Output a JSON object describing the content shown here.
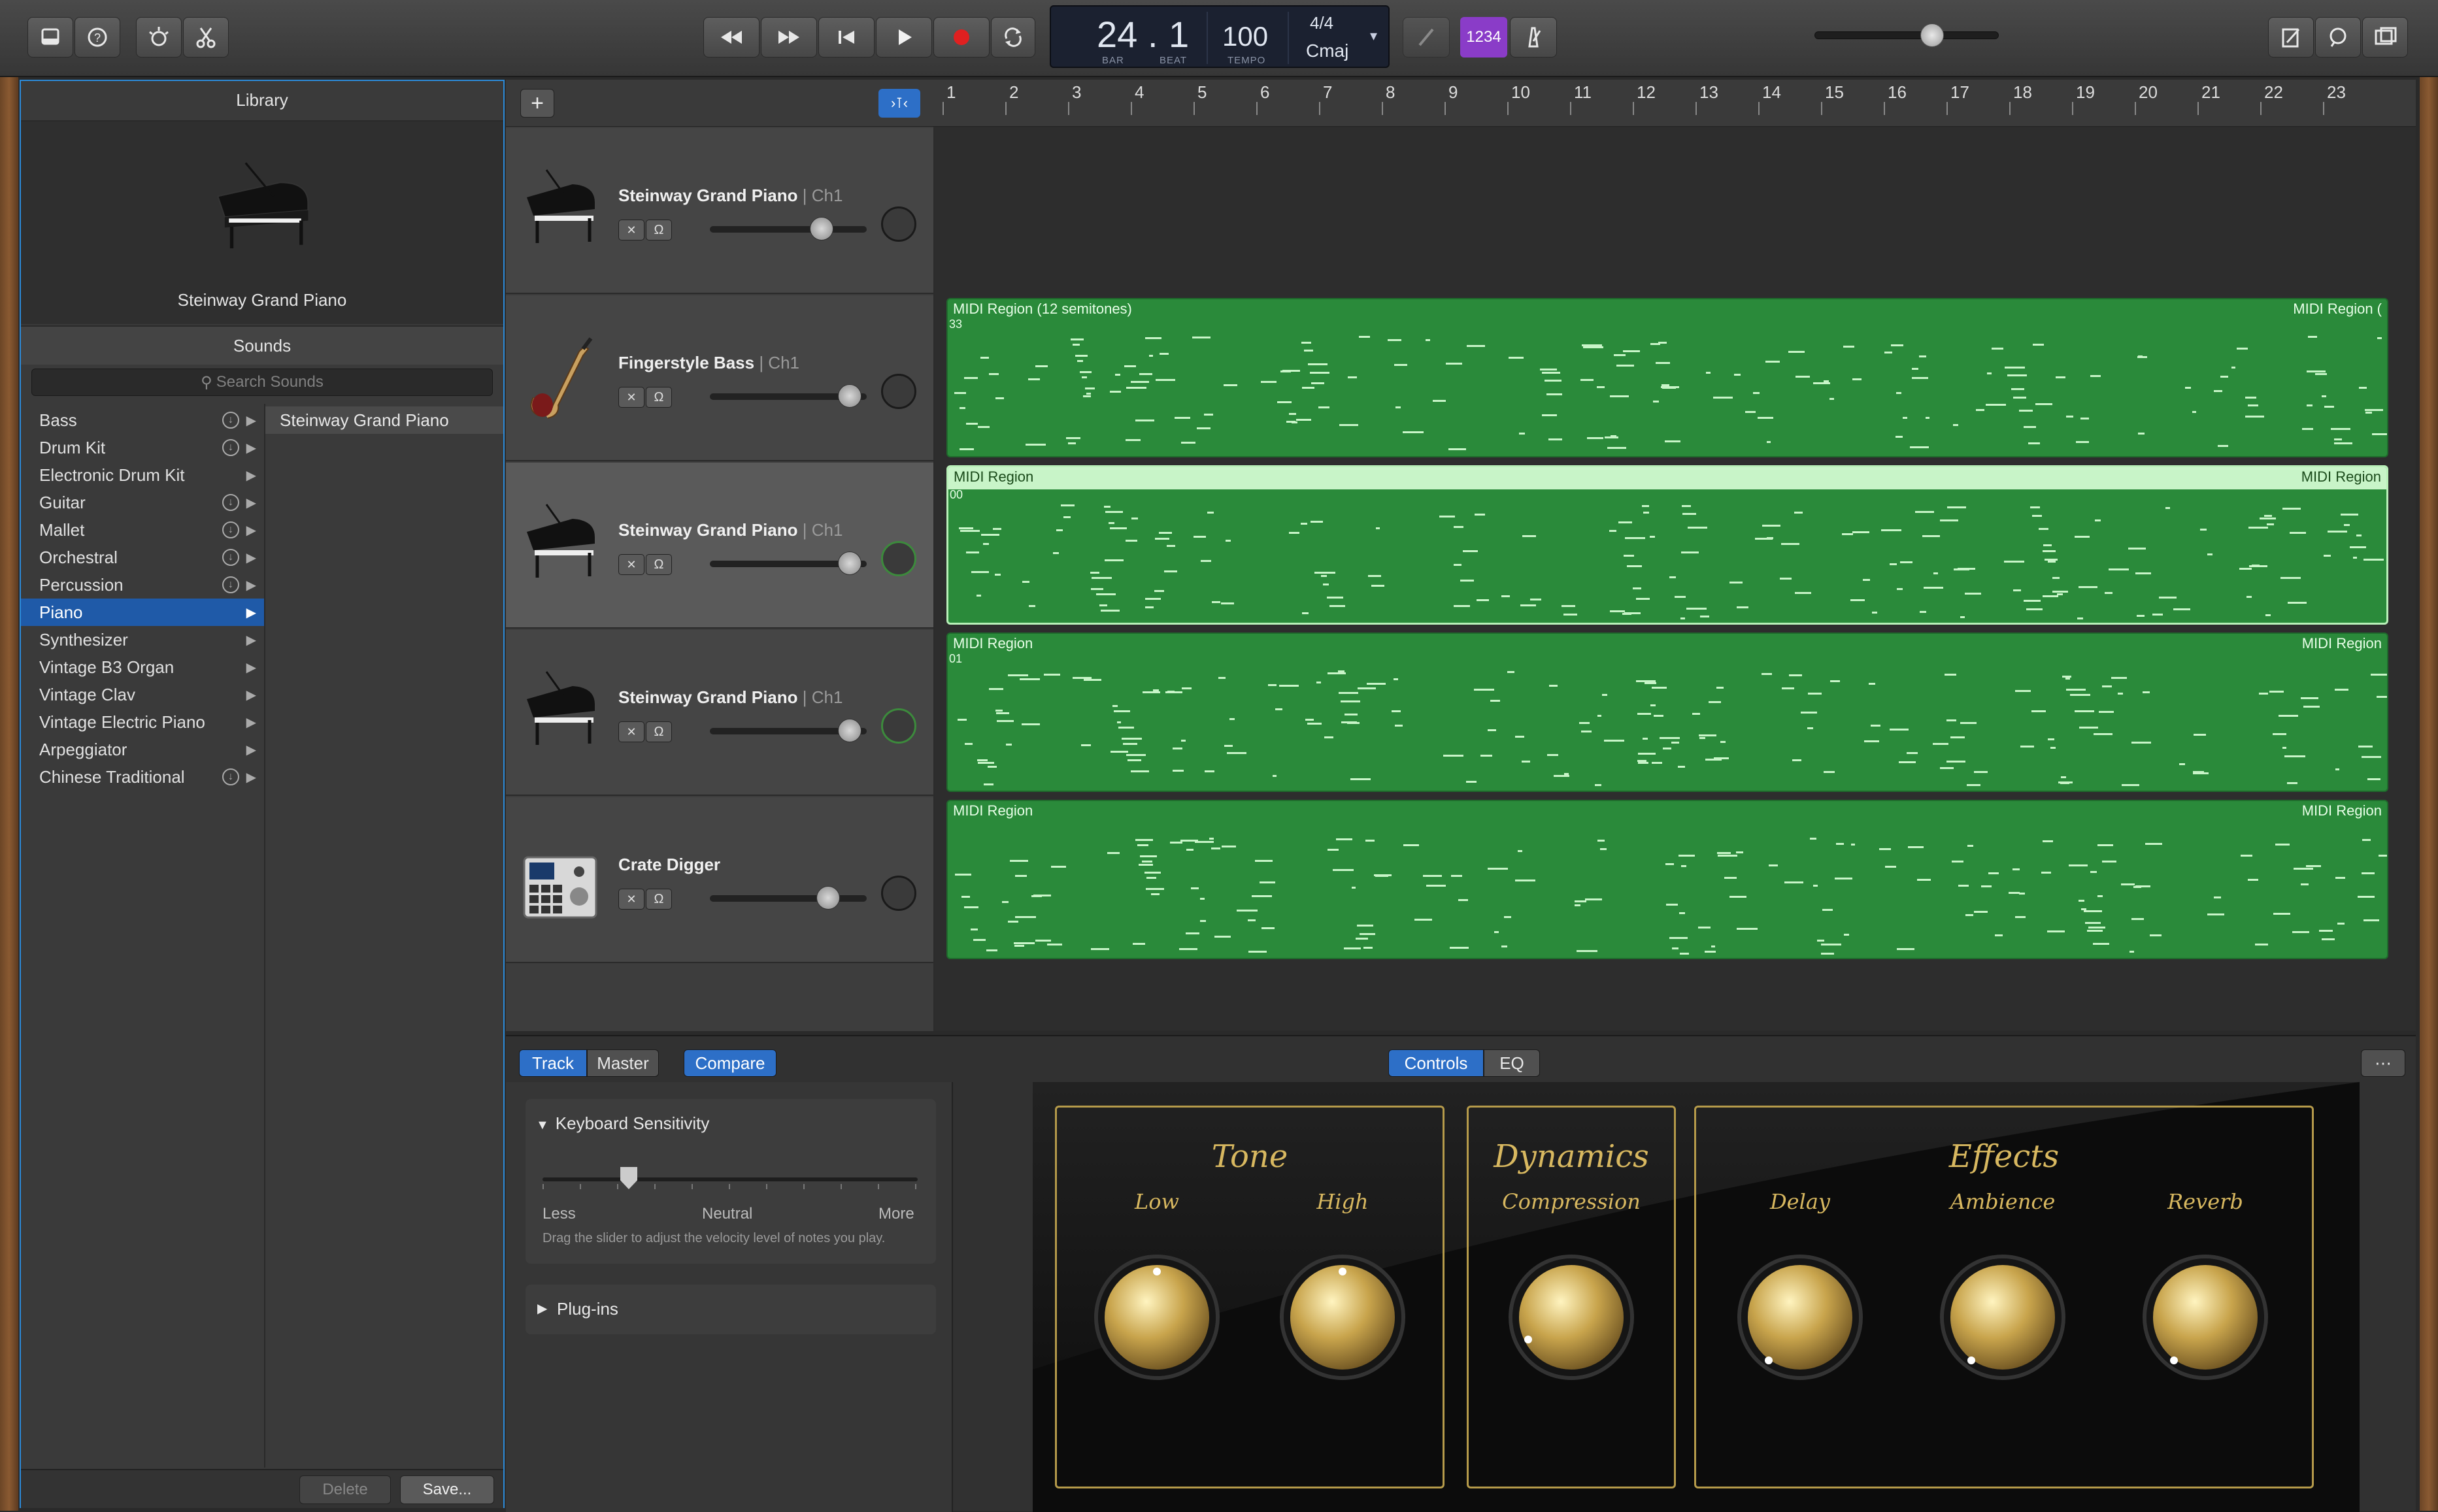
{
  "colors": {
    "region_green": "#2a8a3a",
    "selection_blue": "#2d6fc7",
    "record_red": "#e02020",
    "count_in_purple": "#8a3cc8",
    "gold": "#d8b860"
  },
  "toolbar": {
    "icons": [
      "library-icon",
      "help-icon",
      "smart-controls-icon",
      "editors-icon",
      "rewind-icon",
      "fast-forward-icon",
      "go-to-start-icon",
      "play-icon",
      "record-icon",
      "cycle-icon",
      "tuner-icon",
      "metronome-icon",
      "notepad-icon",
      "loop-browser-icon",
      "media-browser-icon"
    ],
    "lcd": {
      "bar": "24",
      "beat": "1",
      "bar_label": "BAR",
      "beat_label": "BEAT",
      "tempo": "100",
      "tempo_label": "TEMPO",
      "time_sig": "4/4",
      "key": "Cmaj"
    },
    "count_in": "1234",
    "master_volume": 0.66
  },
  "library": {
    "title": "Library",
    "patch_name": "Steinway Grand Piano",
    "sounds_title": "Sounds",
    "search_placeholder": "Search Sounds",
    "categories": [
      {
        "label": "Bass",
        "download": true
      },
      {
        "label": "Drum Kit",
        "download": true
      },
      {
        "label": "Electronic Drum Kit",
        "download": false
      },
      {
        "label": "Guitar",
        "download": true
      },
      {
        "label": "Mallet",
        "download": true
      },
      {
        "label": "Orchestral",
        "download": true
      },
      {
        "label": "Percussion",
        "download": true
      },
      {
        "label": "Piano",
        "download": false,
        "selected": true
      },
      {
        "label": "Synthesizer",
        "download": false
      },
      {
        "label": "Vintage B3 Organ",
        "download": false
      },
      {
        "label": "Vintage Clav",
        "download": false
      },
      {
        "label": "Vintage Electric Piano",
        "download": false
      },
      {
        "label": "Arpeggiator",
        "download": false
      },
      {
        "label": "Chinese Traditional",
        "download": true
      }
    ],
    "patches": [
      "Steinway Grand Piano"
    ],
    "delete_label": "Delete",
    "save_label": "Save..."
  },
  "tracks": [
    {
      "name": "Steinway Grand Piano",
      "channel": "| Ch1",
      "icon": "grand-piano-icon",
      "volume": 0.75
    },
    {
      "name": "Fingerstyle Bass",
      "channel": "| Ch1",
      "icon": "bass-guitar-icon",
      "volume": 0.96
    },
    {
      "name": "Steinway Grand Piano",
      "channel": "| Ch1",
      "icon": "grand-piano-icon",
      "volume": 0.96,
      "selected": true
    },
    {
      "name": "Steinway Grand Piano",
      "channel": "| Ch1",
      "icon": "grand-piano-icon",
      "volume": 0.96
    },
    {
      "name": "Crate Digger",
      "channel": "",
      "icon": "drum-machine-icon",
      "volume": 0.8
    }
  ],
  "ruler": [
    "1",
    "2",
    "3",
    "4",
    "5",
    "6",
    "7",
    "8",
    "9",
    "10",
    "11",
    "12",
    "13",
    "14",
    "15",
    "16",
    "17",
    "18",
    "19",
    "20",
    "21",
    "22",
    "23"
  ],
  "regions": [
    {
      "track": 1,
      "left_label": "MIDI Region (12 semitones)",
      "right_label": "MIDI Region (",
      "sub": "33"
    },
    {
      "track": 2,
      "left_label": "MIDI Region",
      "right_label": "MIDI Region",
      "sub": "00",
      "selected": true
    },
    {
      "track": 3,
      "left_label": "MIDI Region",
      "right_label": "MIDI Region",
      "sub": "01"
    },
    {
      "track": 4,
      "left_label": "MIDI Region",
      "right_label": "MIDI Region",
      "sub": ""
    }
  ],
  "bottom": {
    "tabs": {
      "track": "Track",
      "master": "Master",
      "compare": "Compare"
    },
    "view_tabs": {
      "controls": "Controls",
      "eq": "EQ"
    },
    "keyboard_sensitivity": {
      "title": "Keyboard Sensitivity",
      "less": "Less",
      "neutral": "Neutral",
      "more": "More",
      "hint": "Drag the slider to adjust the velocity level of notes you play.",
      "value": 0.23
    },
    "plugins_label": "Plug-ins",
    "instrument": {
      "tone": {
        "title": "Tone",
        "low": "Low",
        "high": "High"
      },
      "dynamics": {
        "title": "Dynamics",
        "compression": "Compression"
      },
      "effects": {
        "title": "Effects",
        "delay": "Delay",
        "ambience": "Ambience",
        "reverb": "Reverb"
      }
    }
  }
}
